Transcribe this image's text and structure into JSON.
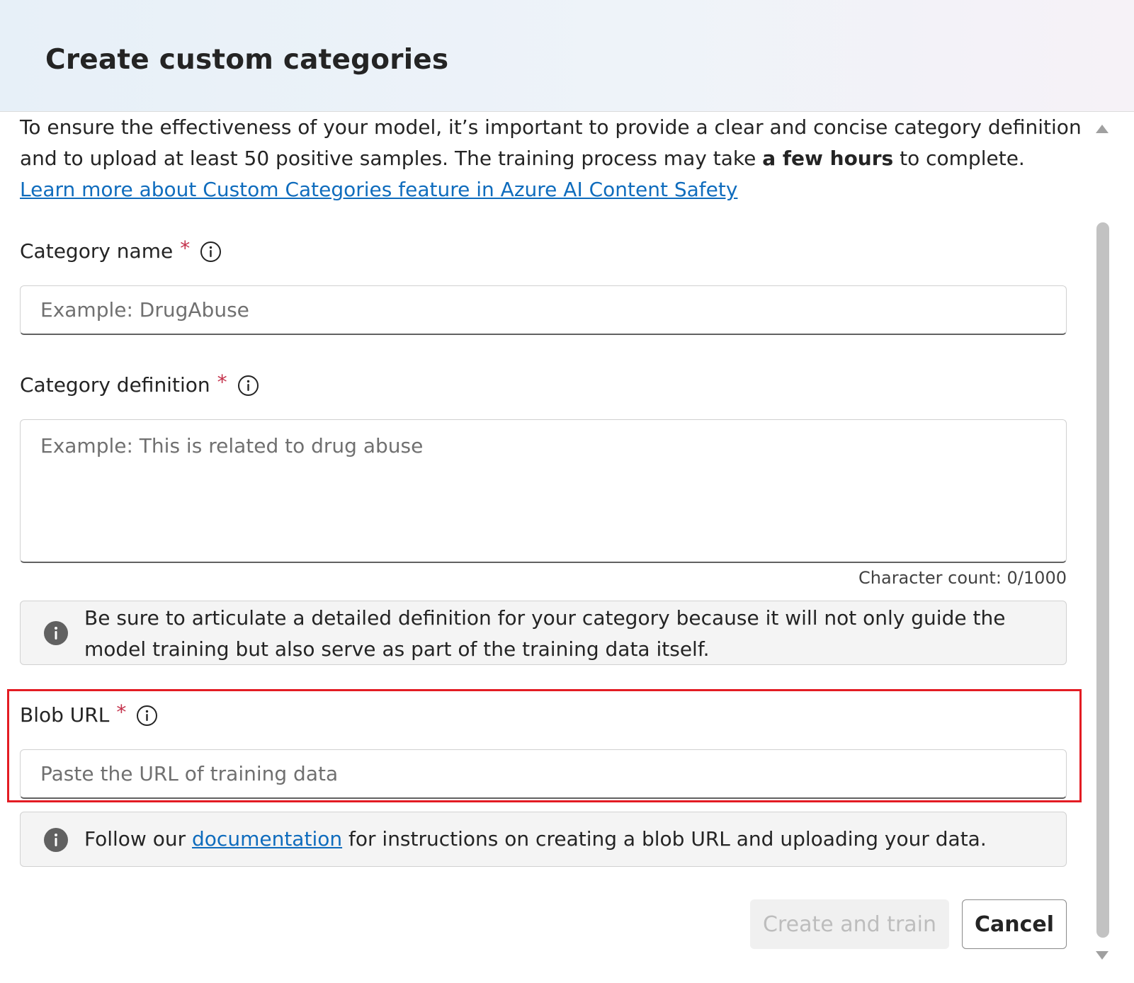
{
  "dialog": {
    "title": "Create custom categories"
  },
  "intro": {
    "text_before_bold": "To ensure the effectiveness of your model, it’s important to provide a clear and concise category definition and to upload at least 50 positive samples. The training process may take ",
    "bold_text": "a few hours",
    "text_after_bold": " to complete. ",
    "link_text": "Learn more about Custom Categories feature in Azure AI Content Safety"
  },
  "category_name": {
    "label": "Category name",
    "required_mark": "*",
    "placeholder": "Example: DrugAbuse",
    "info_icon": "info-outline-icon"
  },
  "category_definition": {
    "label": "Category definition",
    "required_mark": "*",
    "placeholder": "Example: This is related to drug abuse",
    "character_count": "Character count: 0/1000",
    "info_icon": "info-outline-icon"
  },
  "definition_message": {
    "icon": "info-filled-icon",
    "text": "Be sure to articulate a detailed definition for your category because it will not only guide the model training but also serve as part of the training data itself."
  },
  "blob_url": {
    "label": "Blob URL",
    "required_mark": "*",
    "placeholder": "Paste the URL of training data",
    "info_icon": "info-outline-icon",
    "highlight_color": "#e31c23"
  },
  "blob_message": {
    "icon": "info-filled-icon",
    "text_before_link": "Follow our ",
    "link_text": "documentation",
    "text_after_link": " for instructions on creating a blob URL and uploading your data."
  },
  "buttons": {
    "create_label": "Create and train",
    "cancel_label": "Cancel"
  },
  "colors": {
    "link": "#0f6cbd",
    "required": "#c4314b",
    "disabled_button_bg": "#f0f0f0",
    "disabled_button_text": "#bdbdbd"
  }
}
